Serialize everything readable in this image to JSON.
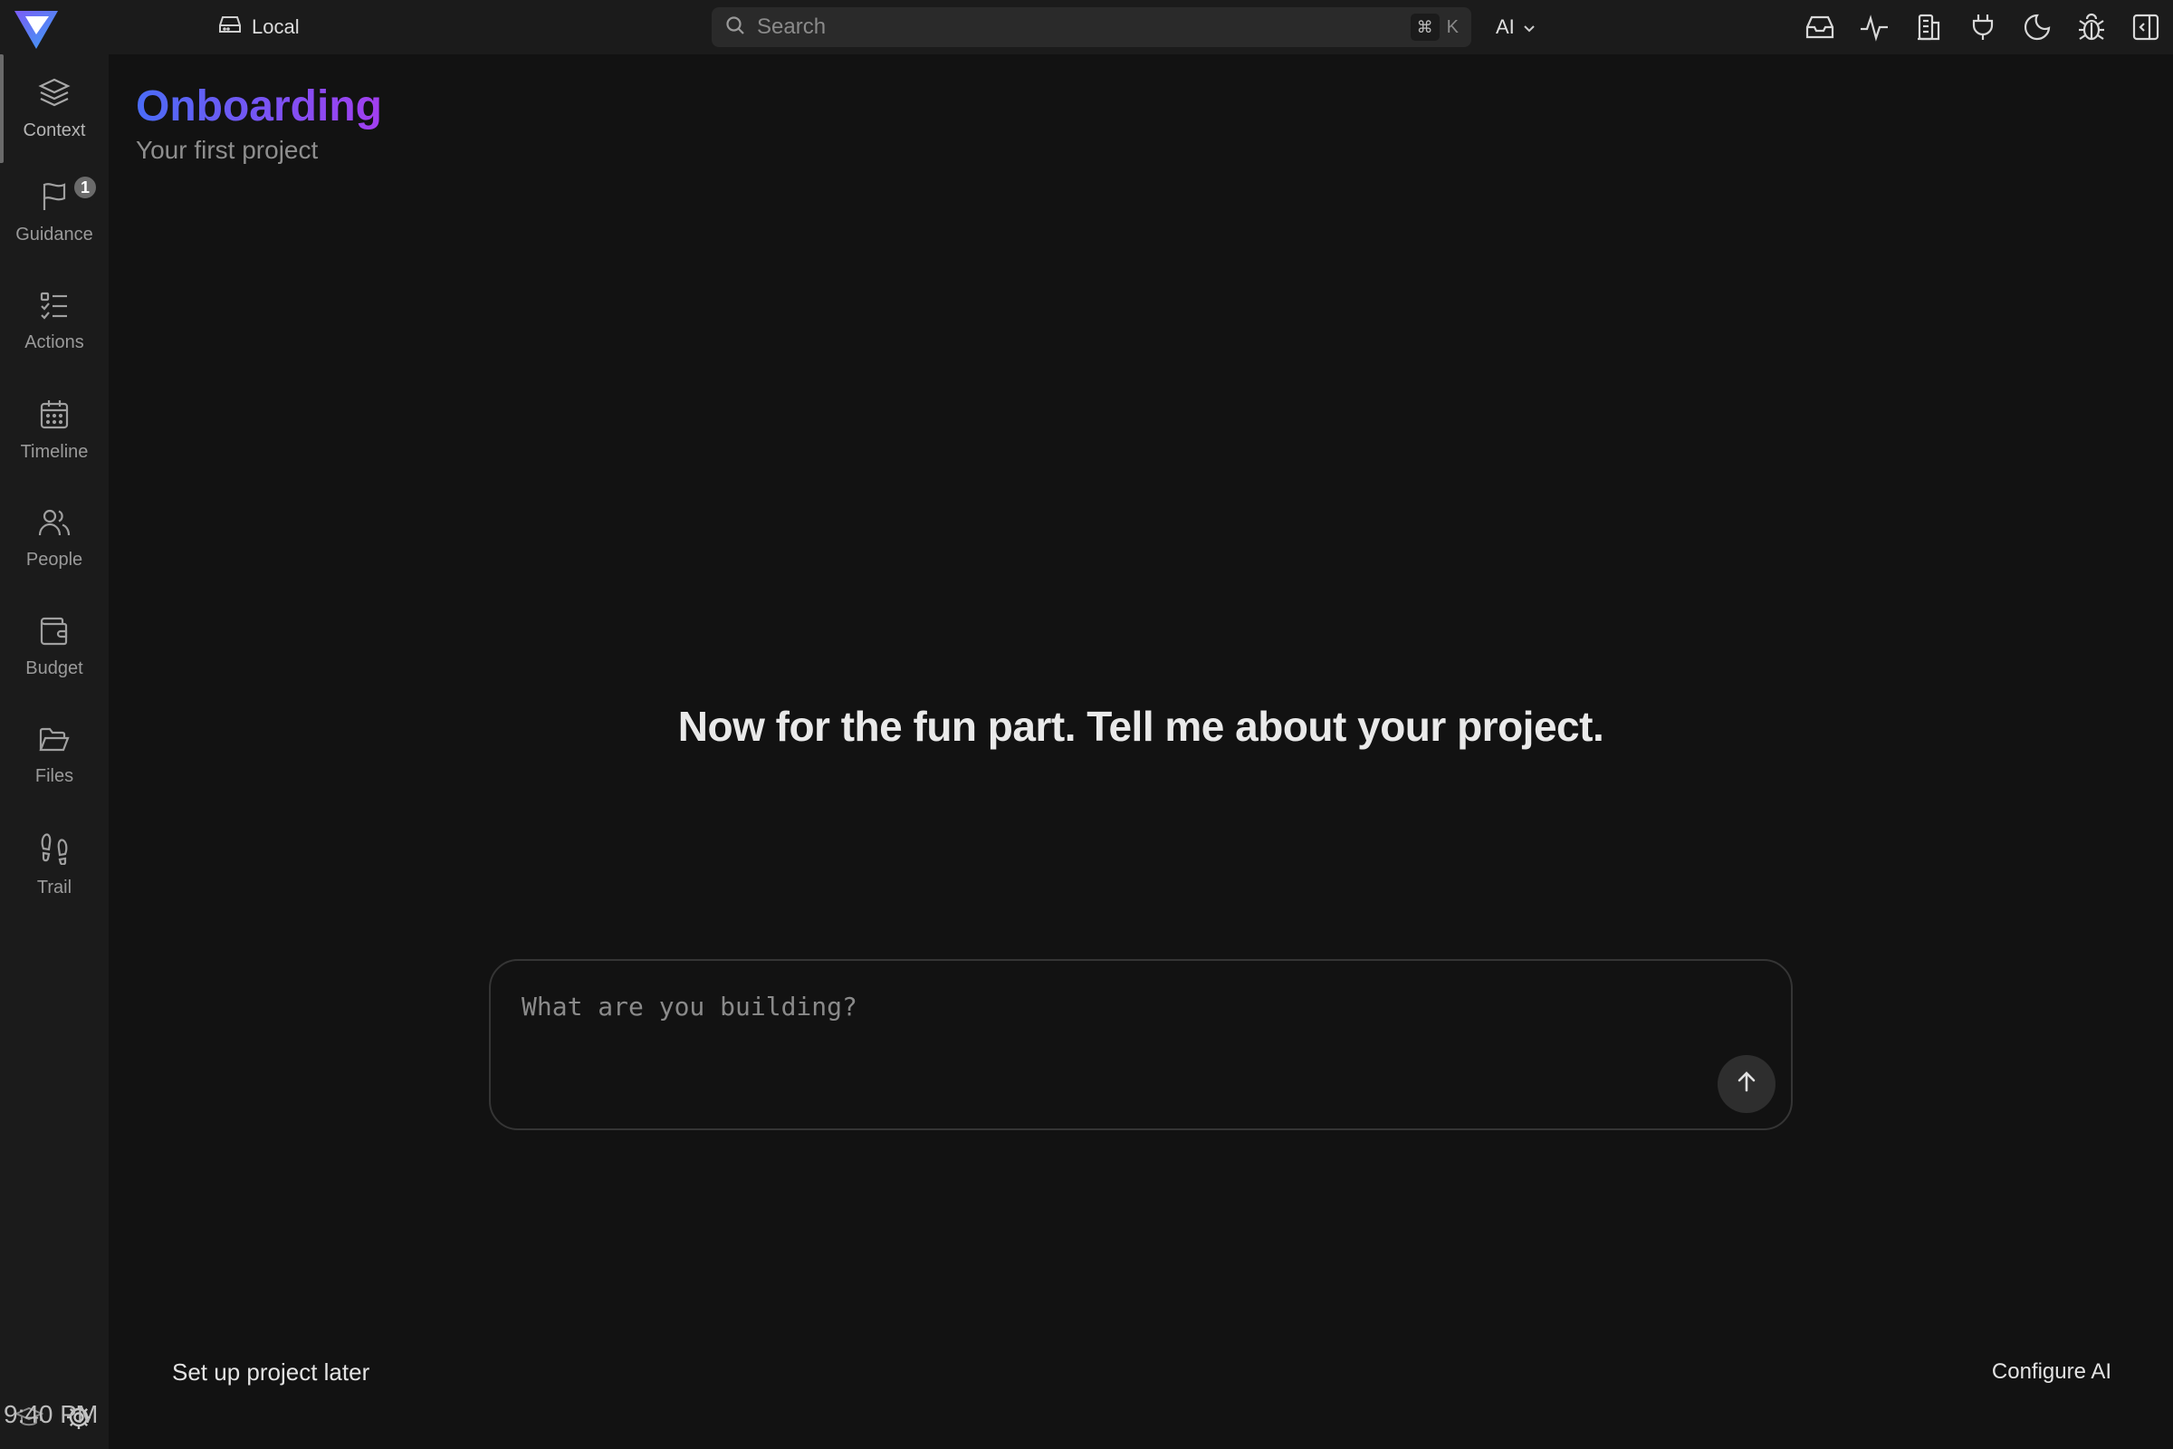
{
  "topbar": {
    "workspace_label": "Local",
    "search": {
      "placeholder": "Search",
      "shortcut_modifier": "⌘",
      "shortcut_key": "K"
    },
    "ai_selector": {
      "label": "AI"
    },
    "icons": [
      "inbox-icon",
      "activity-icon",
      "building-icon",
      "plug-icon",
      "moon-icon",
      "bug-icon",
      "panel-toggle-icon"
    ]
  },
  "sidebar": {
    "items": [
      {
        "label": "Context",
        "icon": "layers-icon",
        "active": true
      },
      {
        "label": "Guidance",
        "icon": "flag-icon",
        "badge": "1"
      },
      {
        "label": "Actions",
        "icon": "checklist-icon"
      },
      {
        "label": "Timeline",
        "icon": "calendar-icon"
      },
      {
        "label": "People",
        "icon": "people-icon"
      },
      {
        "label": "Budget",
        "icon": "wallet-icon"
      },
      {
        "label": "Files",
        "icon": "folder-icon"
      },
      {
        "label": "Trail",
        "icon": "footprints-icon"
      }
    ],
    "clock": "9:40 PM"
  },
  "main": {
    "title": "Onboarding",
    "subtitle": "Your first project",
    "prompt": "Now for the fun part. Tell me about your project.",
    "composer": {
      "placeholder": "What are you building?"
    },
    "footer": {
      "later_label": "Set up project later",
      "configure_label": "Configure AI"
    }
  },
  "colors": {
    "title_gradient_start": "#4a6cf7",
    "title_gradient_end": "#a33ef0",
    "background": "#121212",
    "sidebar": "#1b1b1b"
  }
}
